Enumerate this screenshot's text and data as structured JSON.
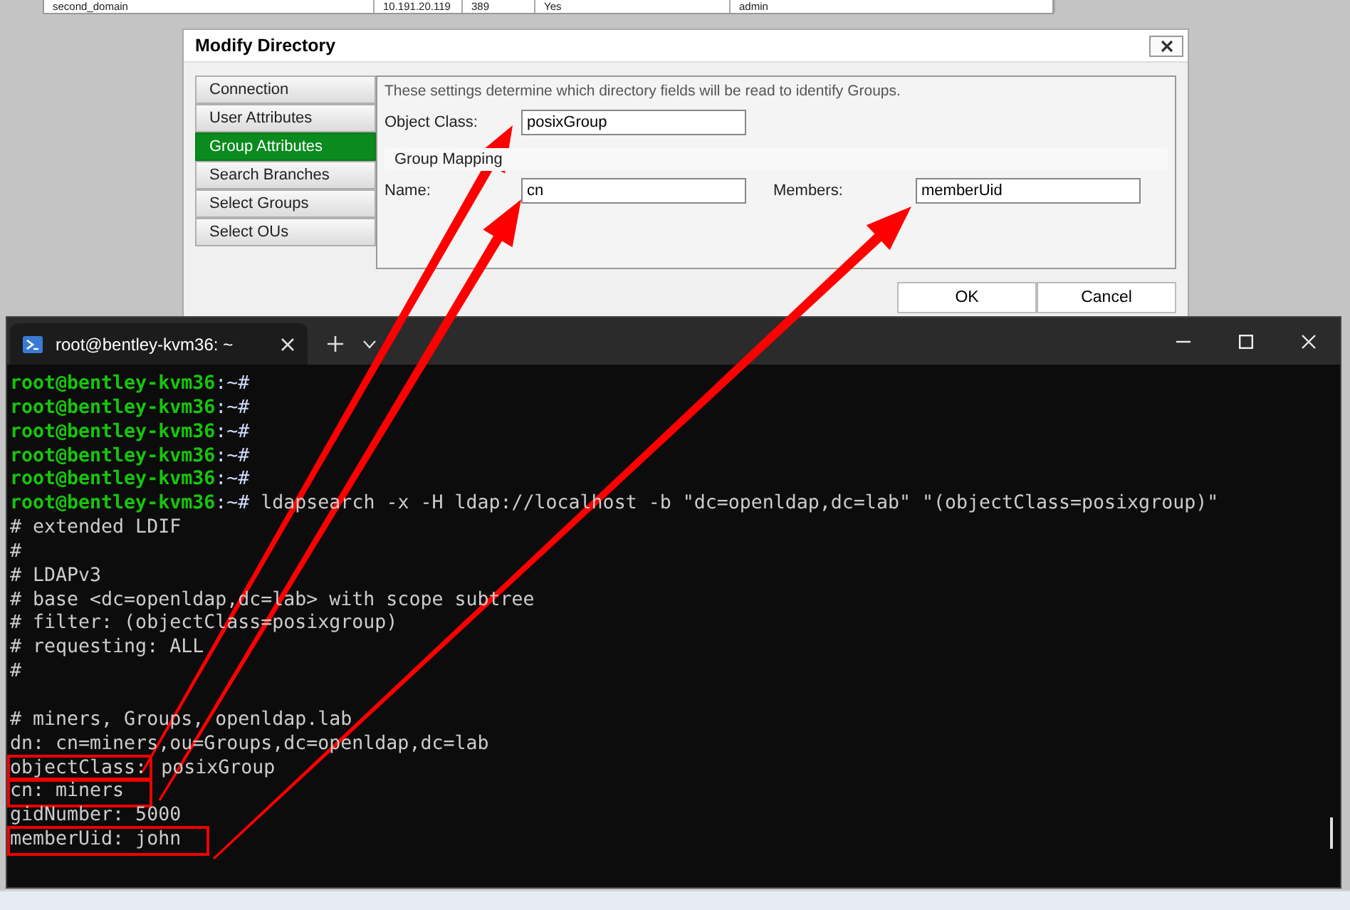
{
  "background_table": {
    "row": [
      "second_domain",
      "10.191.20.119",
      "389",
      "Yes",
      "admin"
    ]
  },
  "dialog": {
    "title": "Modify Directory",
    "tabs": [
      {
        "label": "Connection",
        "selected": false
      },
      {
        "label": "User Attributes",
        "selected": false
      },
      {
        "label": "Group Attributes",
        "selected": true
      },
      {
        "label": "Search Branches",
        "selected": false
      },
      {
        "label": "Select Groups",
        "selected": false
      },
      {
        "label": "Select OUs",
        "selected": false
      }
    ],
    "description": "These settings determine which directory fields will be read to identify Groups.",
    "object_class": {
      "label": "Object Class:",
      "value": "posixGroup"
    },
    "group_mapping": {
      "legend": "Group Mapping",
      "name": {
        "label": "Name:",
        "value": "cn"
      },
      "members": {
        "label": "Members:",
        "value": "memberUid"
      }
    },
    "buttons": [
      "OK",
      "Cancel"
    ]
  },
  "terminal": {
    "tab_title": "root@bentley-kvm36: ~",
    "lines": [
      {
        "kind": "prompt",
        "user": "root@bentley-kvm36",
        "path": ":~#"
      },
      {
        "kind": "prompt",
        "user": "root@bentley-kvm36",
        "path": ":~#"
      },
      {
        "kind": "prompt",
        "user": "root@bentley-kvm36",
        "path": ":~#"
      },
      {
        "kind": "prompt",
        "user": "root@bentley-kvm36",
        "path": ":~#"
      },
      {
        "kind": "prompt",
        "user": "root@bentley-kvm36",
        "path": ":~#"
      },
      {
        "kind": "prompt",
        "user": "root@bentley-kvm36",
        "path": ":~#",
        "command": "ldapsearch -x -H ldap://localhost -b \"dc=openldap,dc=lab\" \"(objectClass=posixgroup)\""
      },
      {
        "kind": "output",
        "text": "# extended LDIF"
      },
      {
        "kind": "output",
        "text": "#"
      },
      {
        "kind": "output",
        "text": "# LDAPv3"
      },
      {
        "kind": "output",
        "text": "# base <dc=openldap,dc=lab> with scope subtree"
      },
      {
        "kind": "output",
        "text": "# filter: (objectClass=posixgroup)"
      },
      {
        "kind": "output",
        "text": "# requesting: ALL"
      },
      {
        "kind": "output",
        "text": "#"
      },
      {
        "kind": "blank"
      },
      {
        "kind": "output",
        "text": "# miners, Groups, openldap.lab"
      },
      {
        "kind": "output",
        "text": "dn: cn=miners,ou=Groups,dc=openldap,dc=lab"
      },
      {
        "kind": "boxed",
        "boxed": "objectClass:",
        "rest": " posixGroup"
      },
      {
        "kind": "boxed",
        "boxed": "cn: miners"
      },
      {
        "kind": "output",
        "text": "gidNumber: 5000"
      },
      {
        "kind": "boxed",
        "boxed": "memberUid: john"
      }
    ]
  }
}
